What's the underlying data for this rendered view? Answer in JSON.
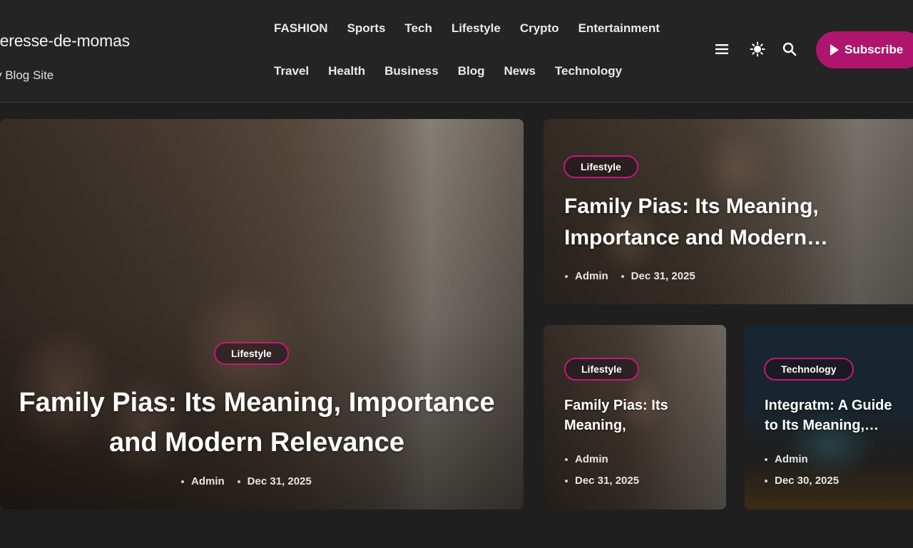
{
  "brand": {
    "title": "rteresse-de-momas",
    "tagline": "y Blog Site"
  },
  "nav": {
    "row1": [
      "FASHION",
      "Sports",
      "Tech",
      "Lifestyle",
      "Crypto",
      "Entertainment"
    ],
    "row2": [
      "Travel",
      "Health",
      "Business",
      "Blog",
      "News",
      "Technology"
    ]
  },
  "header_icons": [
    "menu-icon",
    "sun-icon",
    "search-icon"
  ],
  "subscribe": {
    "label": "Subscribe",
    "color": "#b0156e"
  },
  "posts": {
    "main": {
      "category": "Lifestyle",
      "title": "Family Pias: Its Meaning, Importance and Modern Relevance",
      "author": "Admin",
      "date": "Dec 31, 2025"
    },
    "top_right": {
      "category": "Lifestyle",
      "title": "Family Pias: Its Meaning, Importance and Modern…",
      "author": "Admin",
      "date": "Dec 31, 2025"
    },
    "bottom_left": {
      "category": "Lifestyle",
      "title": "Family Pias: Its Meaning,",
      "author": "Admin",
      "date": "Dec 31, 2025"
    },
    "bottom_right": {
      "category": "Technology",
      "title": "Integratm: A Guide to Its Meaning,…",
      "author": "Admin",
      "date": "Dec 30, 2025"
    }
  },
  "colors": {
    "background": "#1f1f1f",
    "header": "#242424",
    "accent": "#c2187a"
  }
}
